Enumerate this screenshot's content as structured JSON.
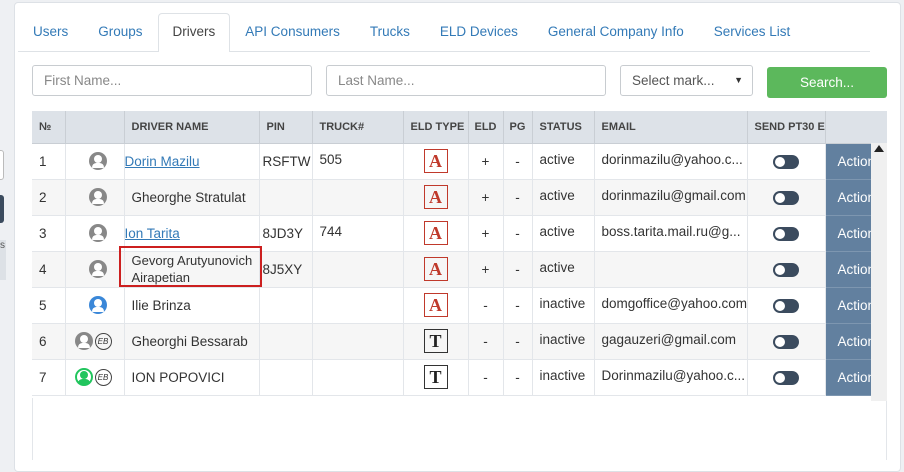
{
  "tabs": [
    {
      "label": "Users"
    },
    {
      "label": "Groups"
    },
    {
      "label": "Drivers"
    },
    {
      "label": "API Consumers"
    },
    {
      "label": "Trucks"
    },
    {
      "label": "ELD Devices"
    },
    {
      "label": "General Company Info"
    },
    {
      "label": "Services List"
    }
  ],
  "active_tab": "Drivers",
  "filters": {
    "first_name_placeholder": "First Name...",
    "last_name_placeholder": "Last Name...",
    "select_mark": "Select mark...",
    "search_label": "Search..."
  },
  "table": {
    "headers": [
      "№",
      "",
      "DRIVER NAME",
      "PIN",
      "TRUCK#",
      "ELD TYPE",
      "ELD",
      "PG",
      "STATUS",
      "EMAIL",
      "SEND PT30 E",
      ""
    ],
    "rows": [
      {
        "num": "1",
        "avatar": "gray",
        "eb": false,
        "name": "Dorin Mazilu",
        "link": true,
        "pin": "RSFTW",
        "truck": "505",
        "eld_type": "A",
        "eld": "+",
        "pg": "-",
        "status": "active",
        "email": "dorinmazilu@yahoo.c...",
        "action": "Action"
      },
      {
        "num": "2",
        "avatar": "gray",
        "eb": false,
        "name": "Gheorghe Stratulat",
        "link": false,
        "pin": "",
        "truck": "",
        "eld_type": "A",
        "eld": "+",
        "pg": "-",
        "status": "active",
        "email": "dorinmazilu@gmail.com",
        "action": "Action"
      },
      {
        "num": "3",
        "avatar": "gray",
        "eb": false,
        "name": "Ion Tarita",
        "link": true,
        "pin": "8JD3Y",
        "truck": "744",
        "eld_type": "A",
        "eld": "+",
        "pg": "-",
        "status": "active",
        "email": "boss.tarita.mail.ru@g...",
        "action": "Action"
      },
      {
        "num": "4",
        "avatar": "gray",
        "eb": false,
        "name": "Gevorg Arutyunovich Airapetian",
        "link": false,
        "pin": "8J5XY",
        "truck": "",
        "eld_type": "A",
        "eld": "+",
        "pg": "-",
        "status": "active",
        "email": "",
        "action": "Action"
      },
      {
        "num": "5",
        "avatar": "blue",
        "eb": false,
        "name": "Ilie Brinza",
        "link": false,
        "pin": "",
        "truck": "",
        "eld_type": "A",
        "eld": "-",
        "pg": "-",
        "status": "inactive",
        "email": "domgoffice@yahoo.com",
        "action": "Action"
      },
      {
        "num": "6",
        "avatar": "gray",
        "eb": true,
        "name": "Gheorghi Bessarab",
        "link": false,
        "pin": "",
        "truck": "",
        "eld_type": "T",
        "eld": "-",
        "pg": "-",
        "status": "inactive",
        "email": "gagauzeri@gmail.com",
        "action": "Action"
      },
      {
        "num": "7",
        "avatar": "green",
        "eb": true,
        "name": "ION POPOVICI",
        "link": false,
        "pin": "",
        "truck": "",
        "eld_type": "T",
        "eld": "-",
        "pg": "-",
        "status": "inactive",
        "email": "Dorinmazilu@yahoo.c...",
        "action": "Action"
      }
    ]
  },
  "eb_label": "EB",
  "left_strip_text": "s"
}
